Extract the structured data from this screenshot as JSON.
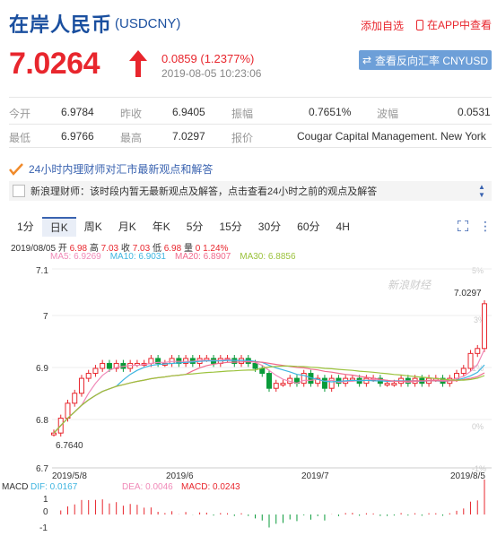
{
  "header": {
    "name": "在岸人民币",
    "code": "(USDCNY)",
    "add_watch": "添加自选",
    "app_view": "在APP中查看"
  },
  "quote": {
    "price": "7.0264",
    "change": "0.0859 (1.2377%)",
    "time": "2019-08-05 10:23:06",
    "reverse_button": "查看反向汇率 CNYUSD"
  },
  "stats": {
    "row1": [
      {
        "label": "今开",
        "value": "6.9784"
      },
      {
        "label": "昨收",
        "value": "6.9405"
      },
      {
        "label": "振幅",
        "value": "0.7651%"
      },
      {
        "label": "波幅",
        "value": "0.0531"
      }
    ],
    "row2": [
      {
        "label": "最低",
        "value": "6.9766"
      },
      {
        "label": "最高",
        "value": "7.0297"
      },
      {
        "label": "报价",
        "value": "Cougar Capital Management. New York"
      }
    ]
  },
  "news": {
    "header": "24小时内理财师对汇市最新观点和解答",
    "item": "新浪理财师：该时段内暂无最新观点及解答，点击查看24小时之前的观点及解答"
  },
  "tabs": [
    "1分",
    "日K",
    "周K",
    "月K",
    "年K",
    "5分",
    "15分",
    "30分",
    "60分",
    "4H"
  ],
  "active_tab": "日K",
  "kline_info": {
    "date": "2019/08/05",
    "open_label": "开",
    "open": "6.98",
    "high_label": "高",
    "high": "7.03",
    "close_label": "收",
    "close": "7.03",
    "low_label": "低",
    "low": "6.98",
    "vol_label": "量",
    "vol": "0",
    "pct": "1.24%"
  },
  "ma": {
    "ma5": "MA5: 6.9269",
    "ma10": "MA10: 6.9031",
    "ma20": "MA20: 6.8907",
    "ma30": "MA30: 6.8856"
  },
  "macd": {
    "label": "MACD",
    "dif": "DIF: 0.0167",
    "dea": "DEA: 0.0046",
    "macd": "MACD: 0.0243"
  },
  "watermark": "新浪财经",
  "colors": {
    "up": "#e8262d",
    "down": "#0a9b3a",
    "blue": "#1a4f9f",
    "ma5": "#f08ab8",
    "ma10": "#3eb5e0",
    "ma20": "#f06b8d",
    "ma30": "#9bc23c"
  },
  "chart_data": {
    "type": "candlestick",
    "y_ticks": [
      "7.1",
      "7",
      "6.9",
      "6.8",
      "6.7"
    ],
    "ylim": [
      6.7,
      7.1
    ],
    "pct_ticks": [
      "5%",
      "3%",
      "1%",
      "0%",
      "-1%"
    ],
    "x_ticks": [
      "2019/5/8",
      "2019/6",
      "2019/7",
      "2019/8/5"
    ],
    "max_label": "7.0297",
    "min_label": "6.7640",
    "macd_ticks": [
      "1",
      "0",
      "-1"
    ],
    "closes": [
      6.77,
      6.8,
      6.83,
      6.85,
      6.88,
      6.89,
      6.9,
      6.91,
      6.9,
      6.91,
      6.9,
      6.91,
      6.91,
      6.91,
      6.92,
      6.91,
      6.91,
      6.92,
      6.91,
      6.92,
      6.91,
      6.92,
      6.92,
      6.91,
      6.92,
      6.92,
      6.91,
      6.92,
      6.91,
      6.9,
      6.89,
      6.86,
      6.87,
      6.87,
      6.88,
      6.87,
      6.89,
      6.87,
      6.88,
      6.86,
      6.88,
      6.87,
      6.88,
      6.88,
      6.87,
      6.88,
      6.88,
      6.87,
      6.87,
      6.87,
      6.88,
      6.87,
      6.88,
      6.87,
      6.88,
      6.88,
      6.87,
      6.88,
      6.89,
      6.9,
      6.93,
      6.94,
      7.03
    ]
  }
}
